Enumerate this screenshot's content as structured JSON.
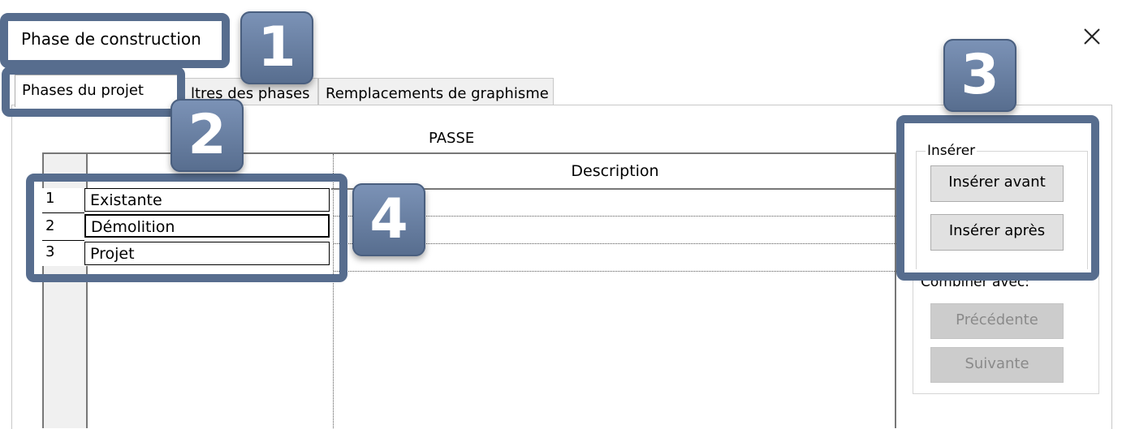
{
  "window": {
    "title": "Phase de construction"
  },
  "tabs": [
    {
      "label": "Phases du projet",
      "active": true
    },
    {
      "label": "Filtres des phases",
      "visible_label": "ltres des phases",
      "active": false
    },
    {
      "label": "Remplacements de graphisme",
      "active": false
    }
  ],
  "panel": {
    "section_label": "PASSE"
  },
  "grid": {
    "columns": [
      "",
      "",
      "Description"
    ],
    "rows": [
      {
        "num": "1",
        "name": "Existante",
        "description": ""
      },
      {
        "num": "2",
        "name": "Démolition",
        "description": ""
      },
      {
        "num": "3",
        "name": "Projet",
        "description": ""
      }
    ]
  },
  "right_panel": {
    "inserer_label": "Insérer",
    "insert_before": "Insérer avant",
    "insert_after": "Insérer après",
    "combiner_label": "Combiner avec:",
    "previous": "Précédente",
    "next": "Suivante"
  },
  "callouts": [
    "1",
    "2",
    "3",
    "4"
  ],
  "colors": {
    "callout": "#576d8e",
    "callout_light": "#7c93b7",
    "disabled_button": "#cccccc",
    "button": "#e1e1e1"
  },
  "icons": {
    "close": "close-icon"
  }
}
